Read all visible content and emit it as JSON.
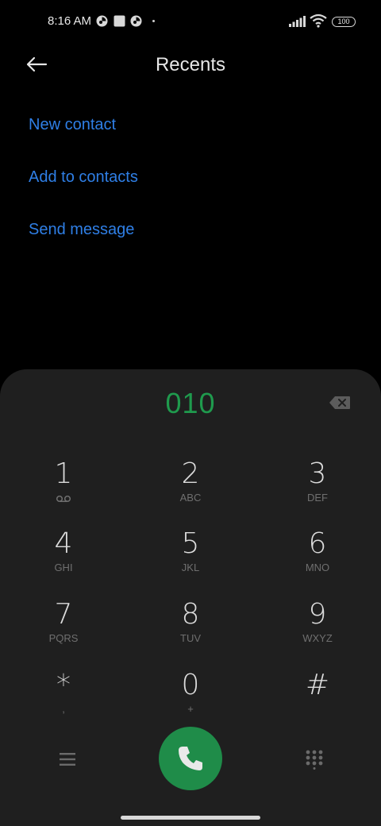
{
  "status_bar": {
    "time": "8:16 AM",
    "battery": "100",
    "icons": [
      "app-notification-icon",
      "square-notification-icon",
      "app-notification-icon",
      "dot-icon",
      "signal-icon",
      "wifi-icon",
      "battery-icon"
    ]
  },
  "header": {
    "title": "Recents",
    "back_icon": "arrow-left-icon"
  },
  "options": [
    {
      "label": "New contact"
    },
    {
      "label": "Add to contacts"
    },
    {
      "label": "Send message"
    }
  ],
  "dialer": {
    "number": "010",
    "backspace_icon": "backspace-icon",
    "keys": [
      {
        "digit": "1",
        "letters": ""
      },
      {
        "digit": "2",
        "letters": "ABC"
      },
      {
        "digit": "3",
        "letters": "DEF"
      },
      {
        "digit": "4",
        "letters": "GHI"
      },
      {
        "digit": "5",
        "letters": "JKL"
      },
      {
        "digit": "6",
        "letters": "MNO"
      },
      {
        "digit": "7",
        "letters": "PQRS"
      },
      {
        "digit": "8",
        "letters": "TUV"
      },
      {
        "digit": "9",
        "letters": "WXYZ"
      },
      {
        "digit": "*",
        "letters": ","
      },
      {
        "digit": "0",
        "letters": "+"
      },
      {
        "digit": "#",
        "letters": ""
      }
    ],
    "bottom": {
      "menu_icon": "menu-icon",
      "call_icon": "phone-icon",
      "keypad_icon": "dialpad-icon"
    },
    "colors": {
      "number": "#1f9a4d",
      "call_button": "#1f8c49",
      "option_link": "#2f7fe6"
    }
  }
}
